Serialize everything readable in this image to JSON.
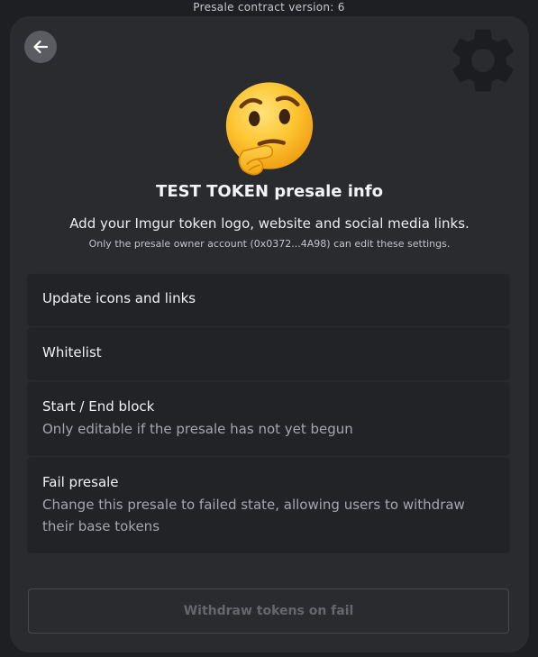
{
  "header": {
    "version_text": "Presale contract version: 6"
  },
  "toolbar": {
    "back_icon": "arrow-left-icon",
    "settings_icon": "gear-icon"
  },
  "hero": {
    "emoji_icon": "thinking-face-icon",
    "title": "TEST TOKEN presale info",
    "subtitle": "Add your Imgur token logo, website and social media links.",
    "note": "Only the presale owner account (0x0372...4A98) can edit these settings."
  },
  "panels": [
    {
      "title": "Update icons and links",
      "description": ""
    },
    {
      "title": "Whitelist",
      "description": ""
    },
    {
      "title": "Start / End block",
      "description": "Only editable if the presale has not yet begun"
    },
    {
      "title": "Fail presale",
      "description": "Change this presale to failed state, allowing users to withdraw their base tokens"
    }
  ],
  "actions": {
    "withdraw_label": "Withdraw tokens on fail"
  },
  "colors": {
    "background": "#1e1f23",
    "card": "#2a2b2f",
    "panel": "#222327",
    "disabled_text": "#65676d"
  }
}
